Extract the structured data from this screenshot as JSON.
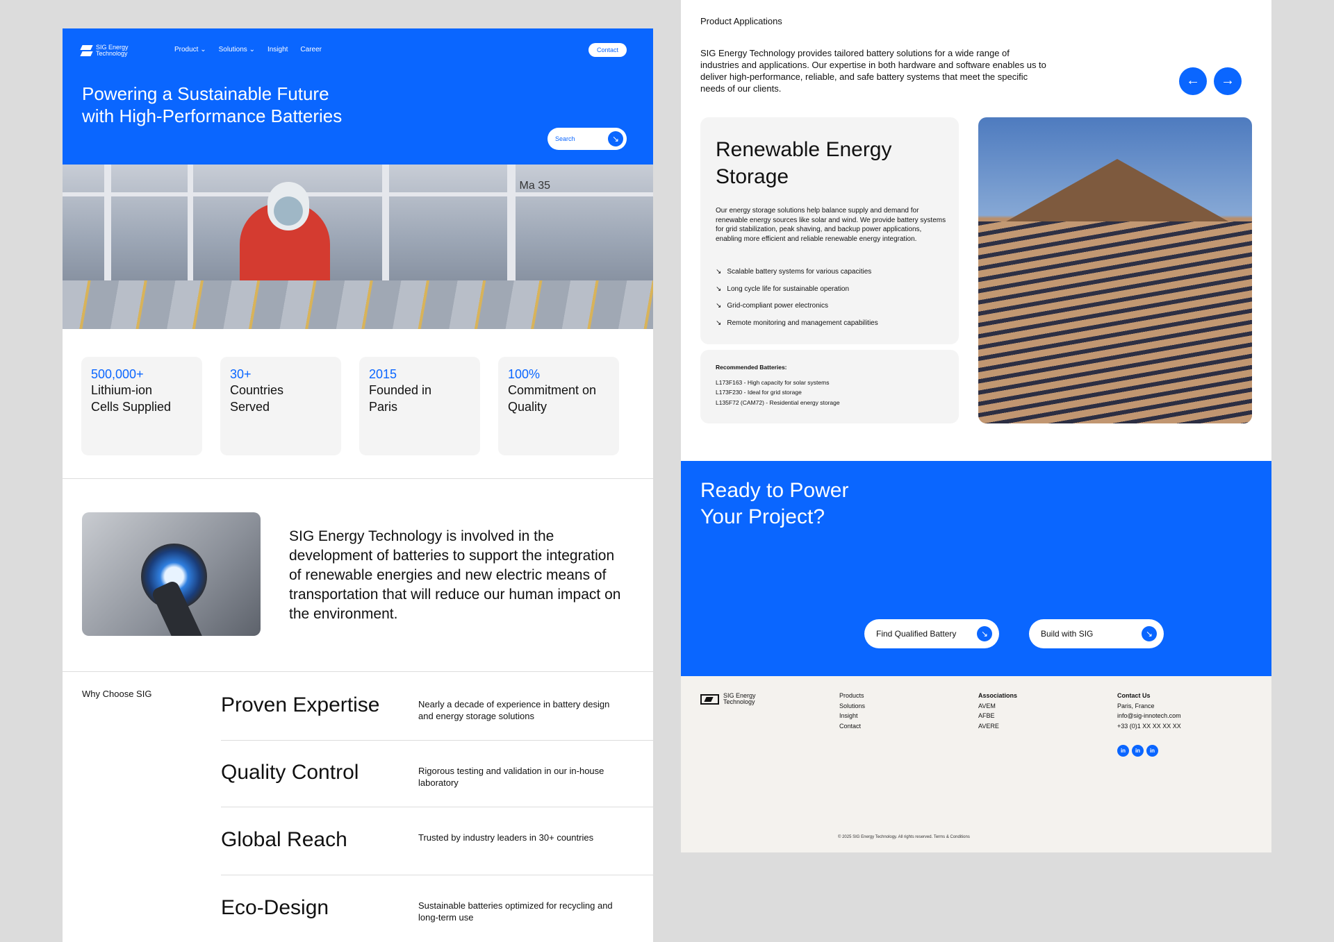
{
  "brand": {
    "name": "SIG Energy Technology",
    "line1": "SIG Energy",
    "line2": "Technology"
  },
  "nav": {
    "items": [
      "Product",
      "Solutions",
      "Insight",
      "Career"
    ],
    "contact": "Contact"
  },
  "hero": {
    "title": "Powering a Sustainable Future with High-Performance Batteries",
    "search_label": "Search"
  },
  "factory_photo": {
    "signage": "Ma 35"
  },
  "stats": [
    {
      "value": "500,000+",
      "label": "Lithium-ion Cells Supplied"
    },
    {
      "value": "30+",
      "label": "Countries Served"
    },
    {
      "value": "2015",
      "label": "Founded in Paris"
    },
    {
      "value": "100%",
      "label": "Commitment on Quality"
    }
  ],
  "about": {
    "text": "SIG Energy Technology is involved in the development of batteries to support the integration of renewable energies and new electric means of transportation that will reduce our human impact on the environment."
  },
  "why": {
    "label": "Why Choose SIG",
    "items": [
      {
        "title": "Proven Expertise",
        "desc": "Nearly a decade of experience in battery design and energy storage solutions"
      },
      {
        "title": "Quality Control",
        "desc": "Rigorous testing and validation in our in-house laboratory"
      },
      {
        "title": "Global Reach",
        "desc": "Trusted by industry leaders in 30+ countries"
      },
      {
        "title": "Eco-Design",
        "desc": "Sustainable batteries optimized for recycling and long-term use"
      }
    ]
  },
  "applications": {
    "label": "Product Applications",
    "desc": "SIG Energy Technology provides tailored battery solutions for a wide range of industries and applications. Our expertise in both hardware and software enables us to deliver high-performance, reliable, and safe battery systems that meet the specific needs of our clients.",
    "card": {
      "title": "Renewable Energy Storage",
      "desc": "Our energy storage solutions help balance supply and demand for renewable energy sources like solar and wind. We provide battery systems for grid stabilization, peak shaving, and backup power applications, enabling more efficient and reliable renewable energy integration.",
      "features": [
        "Scalable battery systems for various capacities",
        "Long cycle life for sustainable operation",
        "Grid-compliant power electronics",
        "Remote monitoring and management capabilities"
      ]
    },
    "recommended": {
      "title": "Recommended Batteries:",
      "items": [
        "L173F163 - High capacity for solar systems",
        "L173F230 - Ideal for grid storage",
        "L135F72 (CAM72) - Residential energy storage"
      ]
    }
  },
  "cta": {
    "title": "Ready to Power Your Project?",
    "btn1": "Find Qualified Battery",
    "btn2": "Build with SIG"
  },
  "footer": {
    "links": [
      "Products",
      "Solutions",
      "Insight",
      "Contact"
    ],
    "associations_title": "Associations",
    "associations": [
      "AVEM",
      "AFBE",
      "AVERE"
    ],
    "contact_title": "Contact Us",
    "contact": [
      "Paris, France",
      "info@sig-innotech.com",
      "+33 (0)1 XX XX XX XX"
    ],
    "social_label": "in",
    "copyright": "© 2025 SIG Energy Technology. All rights reserved. Terms & Conditions"
  },
  "colors": {
    "accent": "#0a66ff",
    "card_bg": "#f4f4f4",
    "footer_bg": "#f4f2ee",
    "outer_bg": "#dcdcdc"
  },
  "icons": [
    "logo-mark",
    "chevron-down-icon",
    "arrow-down-right-icon",
    "arrow-left-icon",
    "arrow-right-icon",
    "linkedin-icon"
  ]
}
